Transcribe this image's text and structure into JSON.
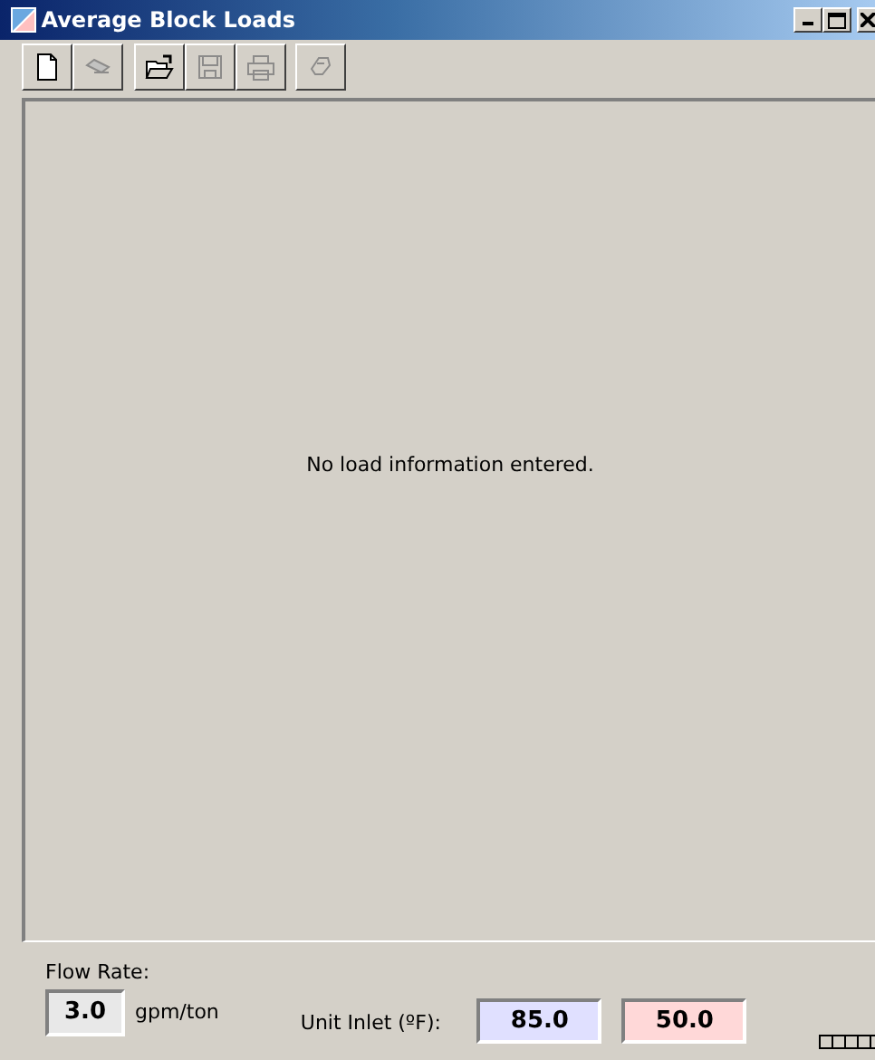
{
  "window": {
    "title": "Average Block Loads"
  },
  "toolbar": [
    {
      "kind": "new",
      "disabled": false,
      "gap_before": false
    },
    {
      "kind": "erase",
      "disabled": true,
      "gap_before": false
    },
    {
      "kind": "open",
      "disabled": false,
      "gap_before": true
    },
    {
      "kind": "save",
      "disabled": true,
      "gap_before": false
    },
    {
      "kind": "print",
      "disabled": true,
      "gap_before": false
    },
    {
      "kind": "export",
      "disabled": true,
      "gap_before": true
    }
  ],
  "message": "No load information entered.",
  "flow_rate": {
    "label": "Flow Rate:",
    "value": "3.0",
    "unit": "gpm/ton"
  },
  "unit_inlet": {
    "label": "Unit Inlet (ºF):",
    "fields": [
      {
        "value": "85.0",
        "color": "#e0e0ff"
      },
      {
        "value": "50.0",
        "color": "#ffd8d8"
      }
    ]
  }
}
